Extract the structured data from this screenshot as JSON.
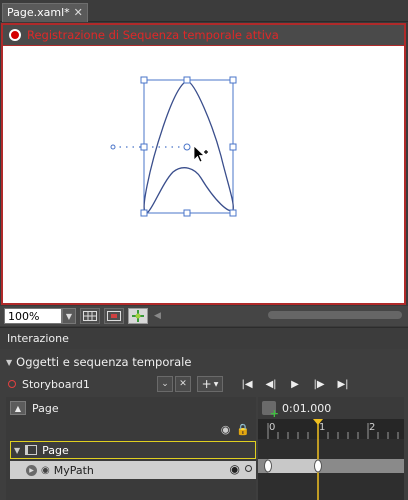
{
  "document_tab": {
    "title": "Page.xaml*",
    "close_glyph": "✕"
  },
  "recording": {
    "message": "Registrazione di Sequenza temporale attiva"
  },
  "view": {
    "zoom": "100%"
  },
  "panel": {
    "title": "Interazione"
  },
  "objects": {
    "section_title": "Oggetti e sequenza temporale",
    "storyboard_name": "Storyboard1",
    "root_label": "Page",
    "tree": [
      {
        "label": "Page",
        "selected": true
      },
      {
        "label": "MyPath",
        "highlighted": true
      }
    ]
  },
  "timeline": {
    "current_time": "0:01.000",
    "ruler_labels": [
      "0",
      "1",
      "2"
    ],
    "playhead_seconds": 1,
    "keyframes_seconds": [
      0,
      1
    ]
  },
  "colors": {
    "recording_red": "#e02828",
    "selection_blue": "#4a74c8",
    "playhead_yellow": "#f0c020",
    "tree_highlight": "#e0d020"
  },
  "icons": [
    "close-icon",
    "record-icon",
    "grid-icon",
    "snap-icon",
    "pan-icon",
    "eye-icon",
    "lock-icon",
    "expand-icon",
    "collapse-icon",
    "close-storyboard-icon",
    "add-icon",
    "first-frame-icon",
    "prev-frame-icon",
    "play-icon",
    "next-frame-icon",
    "last-frame-icon",
    "record-keyframe-icon",
    "mouse-cursor-icon"
  ]
}
